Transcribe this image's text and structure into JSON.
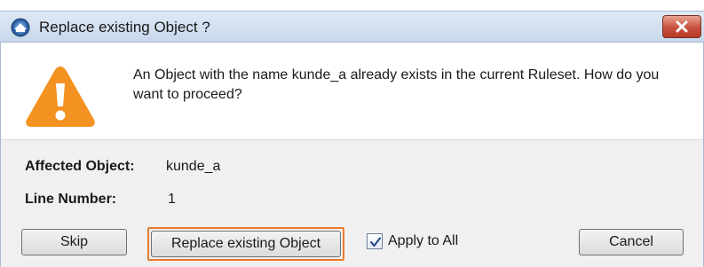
{
  "dialog": {
    "title": "Replace existing Object ?",
    "message": "An Object with the name kunde_a already exists in the current Ruleset. How do you want to proceed?",
    "affected_object_label": "Affected Object:",
    "affected_object_value": "kunde_a",
    "line_number_label": "Line Number:",
    "line_number_value": "1"
  },
  "buttons": {
    "skip": "Skip",
    "replace": "Replace existing Object",
    "cancel": "Cancel"
  },
  "apply_to_all": {
    "label": "Apply to All",
    "checked": true
  },
  "icons": {
    "app": "app-icon",
    "warning": "warning-icon",
    "close": "close-icon",
    "check": "check-icon"
  },
  "colors": {
    "focus_ring": "#ea7a2b",
    "warning": "#f39220",
    "close_button": "#c9513e",
    "titlebar": "#d4e1f1"
  }
}
